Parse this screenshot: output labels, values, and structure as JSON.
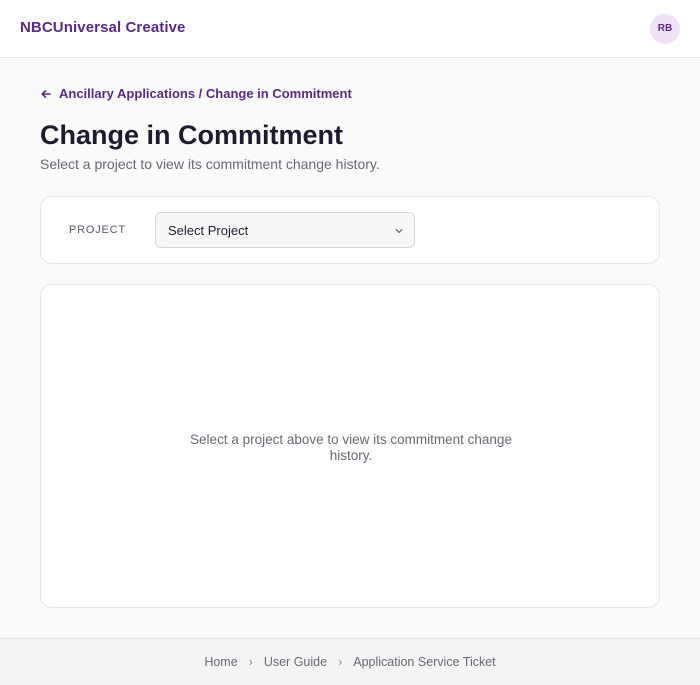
{
  "header": {
    "brand": "NBCUniversal Creative",
    "avatar_initials": "RB"
  },
  "breadcrumb": {
    "text": "Ancillary Applications / Change in Commitment",
    "icon": "arrow-left-icon"
  },
  "page": {
    "title": "Change in Commitment",
    "subtitle": "Select a project to view its commitment change history."
  },
  "filter": {
    "label": "PROJECT",
    "select_value": "Select Project",
    "chevron": "v"
  },
  "history": {
    "empty_message": "Select a project above to view its commitment change history."
  },
  "footer": {
    "links": [
      "Home",
      "User Guide",
      "Application Service Ticket"
    ],
    "separator": "›"
  },
  "colors": {
    "accent": "#5b2a86",
    "avatar_bg": "#efe2f7",
    "muted_text": "#666a73"
  }
}
